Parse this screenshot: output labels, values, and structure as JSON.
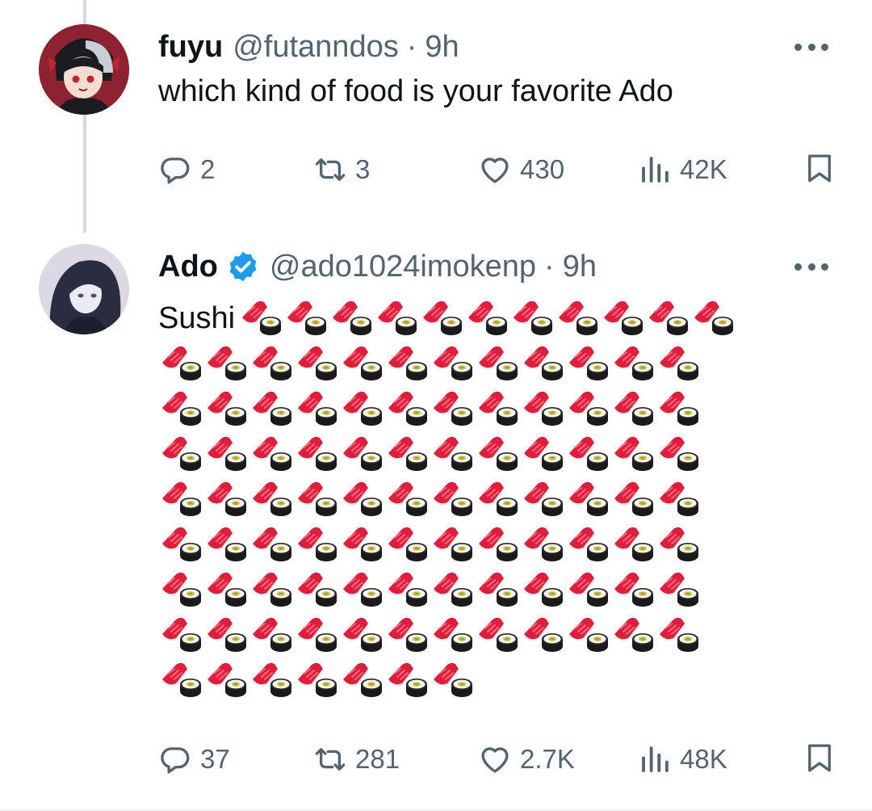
{
  "tweets": [
    {
      "name": "fuyu",
      "handle": "@futanndos",
      "separator": "·",
      "time": "9h",
      "text": "which kind of food is your favorite Ado",
      "verified": false,
      "stats": {
        "replies": "2",
        "retweets": "3",
        "likes": "430",
        "views": "42K"
      }
    },
    {
      "name": "Ado",
      "handle": "@ado1024imokenp",
      "separator": "·",
      "time": "9h",
      "text": "Sushi",
      "verified": true,
      "emoji": {
        "glyph": "sushi",
        "total_count": 102,
        "per_row": 12
      },
      "stats": {
        "replies": "37",
        "retweets": "281",
        "likes": "2.7K",
        "views": "48K"
      }
    }
  ],
  "icons": [
    "reply-icon",
    "retweet-icon",
    "like-icon",
    "views-icon",
    "bookmark-icon",
    "more-icon",
    "verified-badge-icon",
    "sushi-emoji"
  ],
  "colors": {
    "text": "#0f1419",
    "secondary": "#536471",
    "verified": "#1d9bf0",
    "thread_line": "#cfd9de"
  }
}
